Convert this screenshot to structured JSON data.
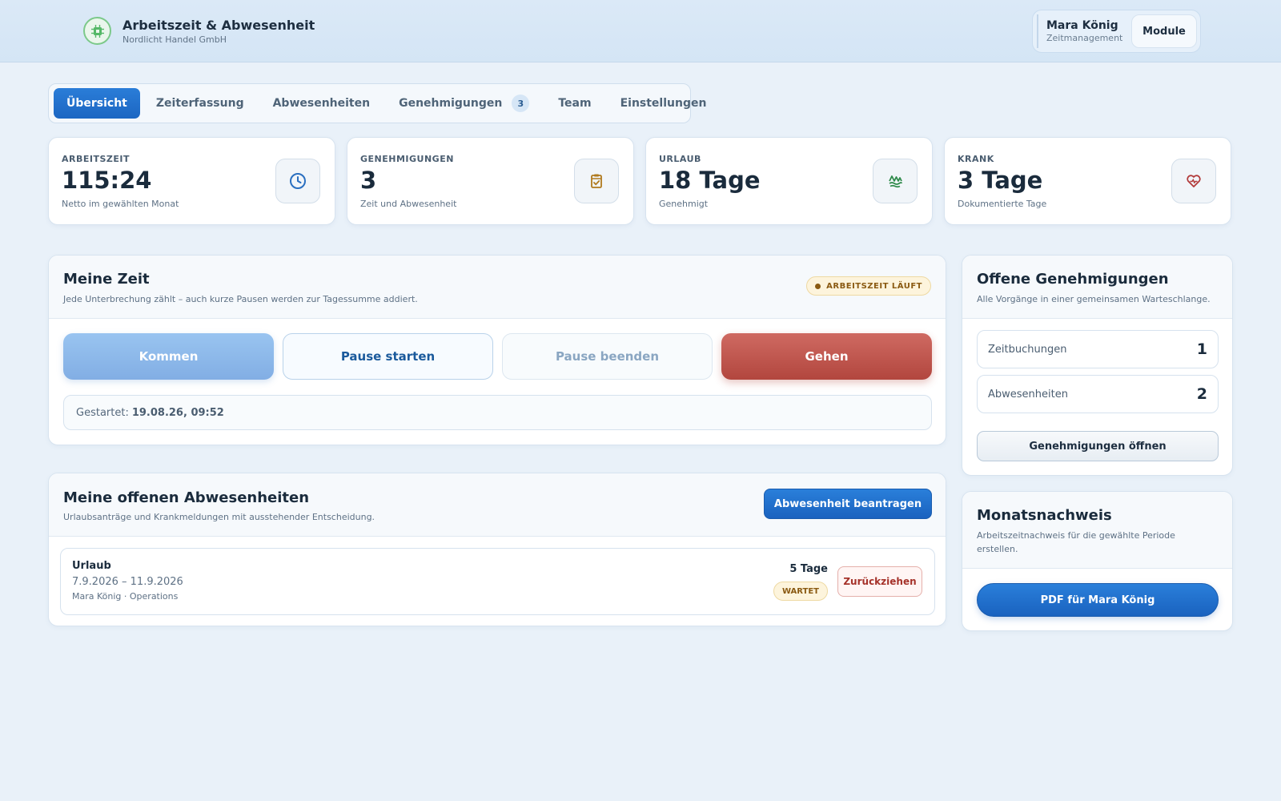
{
  "header": {
    "title": "Arbeitszeit & Abwesenheit",
    "company": "Nordlicht Handel GmbH",
    "user_name": "Mara König",
    "user_role": "Zeitmanagement",
    "modules_label": "Module"
  },
  "tabs": [
    {
      "label": "Übersicht",
      "active": true
    },
    {
      "label": "Zeiterfassung"
    },
    {
      "label": "Abwesenheiten"
    },
    {
      "label": "Genehmigungen",
      "badge": "3"
    },
    {
      "label": "Team"
    },
    {
      "label": "Einstellungen"
    }
  ],
  "stats": [
    {
      "label": "ARBEITSZEIT",
      "value": "115:24",
      "sub": "Netto im gewählten Monat",
      "icon": "clock-icon"
    },
    {
      "label": "GENEHMIGUNGEN",
      "value": "3",
      "sub": "Zeit und Abwesenheit",
      "icon": "clipboard-check-icon"
    },
    {
      "label": "URLAUB",
      "value": "18 Tage",
      "sub": "Genehmigt",
      "icon": "vacation-icon"
    },
    {
      "label": "KRANK",
      "value": "3 Tage",
      "sub": "Dokumentierte Tage",
      "icon": "heart-pulse-icon"
    }
  ],
  "my_time": {
    "title": "Meine Zeit",
    "desc": "Jede Unterbrechung zählt – auch kurze Pausen werden zur Tagessumme addiert.",
    "status": "ARBEITSZEIT LÄUFT",
    "buttons": {
      "come": "Kommen",
      "pause_start": "Pause starten",
      "pause_end": "Pause beenden",
      "leave": "Gehen"
    },
    "started_label": "Gestartet:",
    "started_value": "19.08.26, 09:52"
  },
  "absences": {
    "title": "Meine offenen Abwesenheiten",
    "desc": "Urlaubsanträge und Krankmeldungen mit ausstehender Entscheidung.",
    "request_button": "Abwesenheit beantragen",
    "items": [
      {
        "type": "Urlaub",
        "range": "7.9.2026 – 11.9.2026",
        "person": "Mara König · Operations",
        "days": "5 Tage",
        "status": "WARTET",
        "withdraw": "Zurückziehen"
      }
    ]
  },
  "approvals": {
    "title": "Offene Genehmigungen",
    "desc": "Alle Vorgänge in einer gemeinsamen Warteschlange.",
    "rows": [
      {
        "label": "Zeitbuchungen",
        "count": "1"
      },
      {
        "label": "Abwesenheiten",
        "count": "2"
      }
    ],
    "open_button": "Genehmigungen öffnen"
  },
  "monthly": {
    "title": "Monatsnachweis",
    "desc": "Arbeitszeitnachweis für die gewählte Periode erstellen.",
    "pdf_button": "PDF für Mara König"
  },
  "colors": {
    "primary": "#1c66c2",
    "danger": "#b2463e",
    "warning_bg": "#fdf4dc",
    "background": "#e9f1f9"
  }
}
